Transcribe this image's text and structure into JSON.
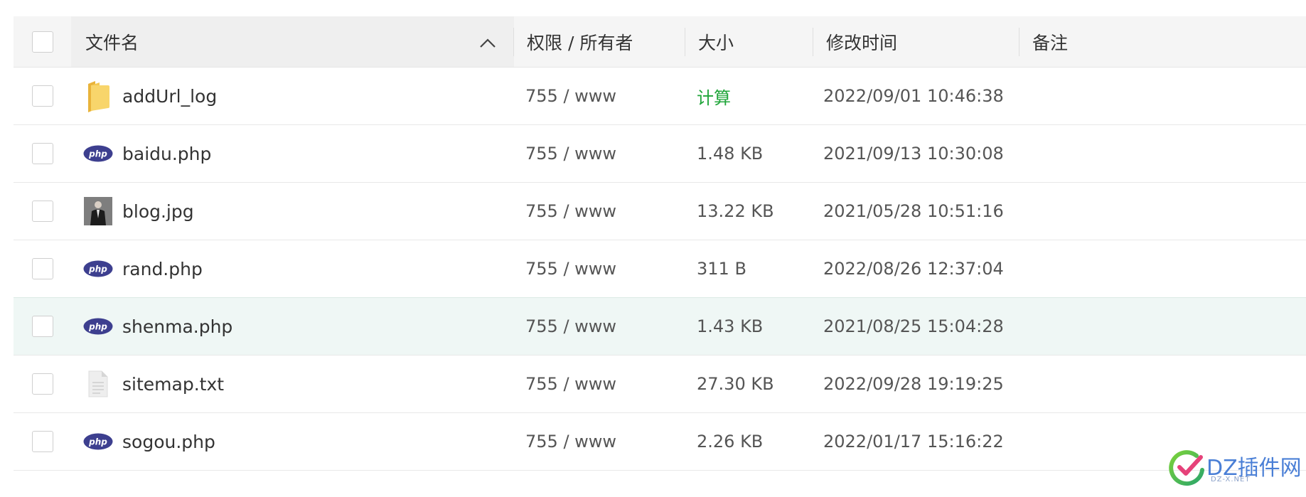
{
  "header": {
    "name": "文件名",
    "perm": "权限 / 所有者",
    "size": "大小",
    "time": "修改时间",
    "note": "备注"
  },
  "files": [
    {
      "name": "addUrl_log",
      "type": "folder",
      "perm": "755 / www",
      "size": "计算",
      "time": "2022/09/01 10:46:38"
    },
    {
      "name": "baidu.php",
      "type": "php",
      "perm": "755 / www",
      "size": "1.48 KB",
      "time": "2021/09/13 10:30:08"
    },
    {
      "name": "blog.jpg",
      "type": "image",
      "perm": "755 / www",
      "size": "13.22 KB",
      "time": "2021/05/28 10:51:16"
    },
    {
      "name": "rand.php",
      "type": "php",
      "perm": "755 / www",
      "size": "311 B",
      "time": "2022/08/26 12:37:04"
    },
    {
      "name": "shenma.php",
      "type": "php",
      "perm": "755 / www",
      "size": "1.43 KB",
      "time": "2021/08/25 15:04:28"
    },
    {
      "name": "sitemap.txt",
      "type": "text",
      "perm": "755 / www",
      "size": "27.30 KB",
      "time": "2022/09/28 19:19:25"
    },
    {
      "name": "sogou.php",
      "type": "php",
      "perm": "755 / www",
      "size": "2.26 KB",
      "time": "2022/01/17 15:16:22"
    }
  ],
  "watermark": {
    "title": "DZ插件网",
    "sub": "DZ-X.NET"
  },
  "colors": {
    "calc_link": "#20a53a",
    "row_hover": "#eff7f5",
    "php_icon": "#3d3f8f",
    "folder_icon": "#f5c542"
  }
}
